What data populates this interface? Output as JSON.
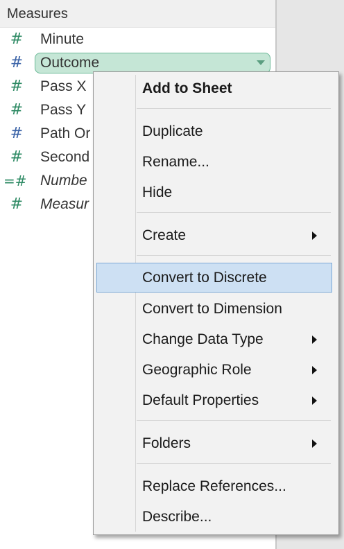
{
  "panel": {
    "section_title": "Measures",
    "fields": [
      {
        "label": "Minute",
        "icon": "hash-icon"
      },
      {
        "label": "Outcome",
        "icon": "hash-icon",
        "selected": true
      },
      {
        "label": "Pass X",
        "icon": "hash-icon"
      },
      {
        "label": "Pass Y",
        "icon": "hash-icon"
      },
      {
        "label": "Path Or",
        "icon": "hash-icon"
      },
      {
        "label": "Second",
        "icon": "hash-icon"
      },
      {
        "label": "Numbe",
        "icon": "calculated-hash-icon",
        "italic": true
      },
      {
        "label": "Measur",
        "icon": "hash-icon",
        "italic": true
      }
    ],
    "icon_glyph": "#",
    "calc_icon_glyph": "=#"
  },
  "context_menu": {
    "items": [
      {
        "label": "Add to Sheet",
        "bold": true
      },
      {
        "label": "Duplicate"
      },
      {
        "label": "Rename..."
      },
      {
        "label": "Hide"
      },
      {
        "label": "Create",
        "submenu": true
      },
      {
        "label": "Convert to Discrete",
        "highlighted": true
      },
      {
        "label": "Convert to Dimension"
      },
      {
        "label": "Change Data Type",
        "submenu": true
      },
      {
        "label": "Geographic Role",
        "submenu": true
      },
      {
        "label": "Default Properties",
        "submenu": true
      },
      {
        "label": "Folders",
        "submenu": true
      },
      {
        "label": "Replace References..."
      },
      {
        "label": "Describe..."
      }
    ]
  },
  "colors": {
    "measure_icon": "#2e8a64",
    "pill_fill": "#c5e6d6",
    "menu_highlight": "#cde0f3"
  }
}
